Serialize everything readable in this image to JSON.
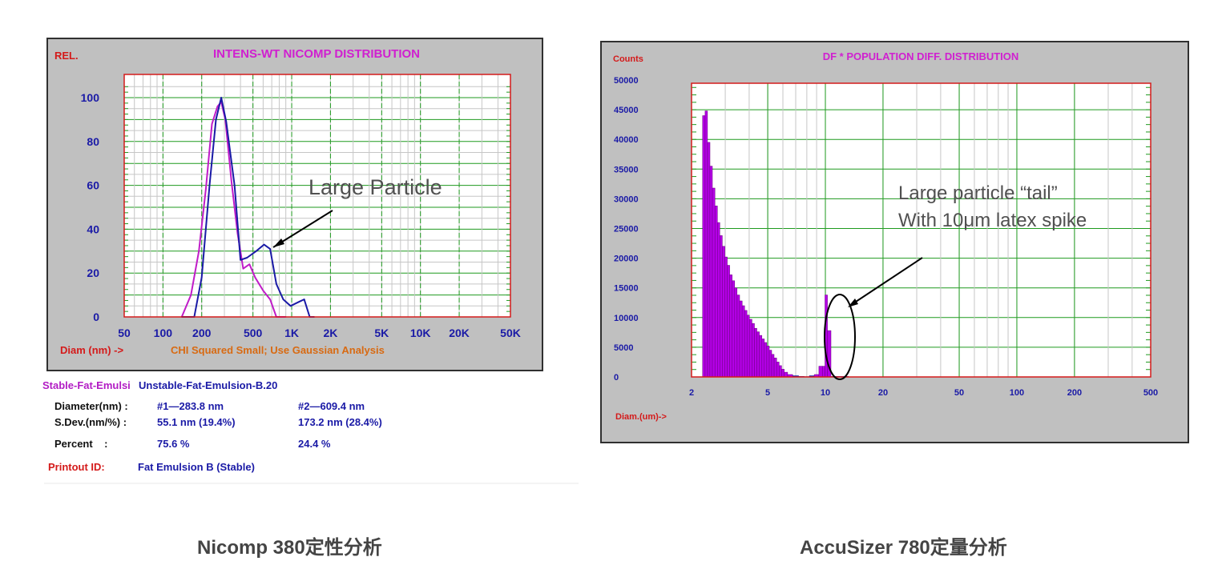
{
  "nicomp": {
    "title": "INTENS-WT NICOMP DISTRIBUTION",
    "y_corner_label": "REL.",
    "x_label": "Diam (nm) ->",
    "status_text": "CHI Squared Small; Use Gaussian Analysis",
    "annotation": "Large Particle",
    "y_ticks": [
      "100",
      "80",
      "60",
      "40",
      "20",
      "0"
    ],
    "x_ticks": [
      "50",
      "100",
      "200",
      "500",
      "1K",
      "2K",
      "5K",
      "10K",
      "20K",
      "50K"
    ],
    "legend": {
      "stable": "Stable-Fat-Emulsi",
      "unstable": "Unstable-Fat-Emulsion-B.20"
    },
    "stats": {
      "diameter_label": "Diameter(nm) :",
      "diameter_1": "#1—283.8 nm",
      "diameter_2": "#2—609.4 nm",
      "sdev_label": "S.Dev.(nm/%) :",
      "sdev_1": "55.1 nm (19.4%)",
      "sdev_2": "173.2 nm (28.4%)",
      "percent_label": "Percent    :",
      "percent_1": "75.6 %",
      "percent_2": "24.4 %",
      "printout_label": "Printout ID:",
      "printout_value": "Fat Emulsion B (Stable)"
    },
    "caption": "Nicomp 380定性分析"
  },
  "accusizer": {
    "title": "DF * POPULATION DIFF. DISTRIBUTION",
    "y_corner_label": "Counts",
    "x_label": "Diam.(um)->",
    "annotation_line1": "Large particle “tail”",
    "annotation_line2": "With 10μm latex spike",
    "y_ticks": [
      "50000",
      "45000",
      "40000",
      "35000",
      "30000",
      "25000",
      "20000",
      "15000",
      "10000",
      "5000",
      "0"
    ],
    "x_ticks": [
      "2",
      "5",
      "10",
      "20",
      "50",
      "100",
      "200",
      "500"
    ],
    "caption": "AccuSizer 780定量分析"
  },
  "colors": {
    "panel_bg": "#c0c0c0",
    "plot_bg": "#ffffff",
    "grid_major": "#1f9a1f",
    "grid_minor": "#c6c6c6",
    "axis_red": "#d41a1a",
    "blue_series": "#1a1aa6",
    "magenta_series": "#c01cc8",
    "bar_fill": "#b400e6",
    "title_magenta": "#d020d0",
    "status_orange": "#d86a12",
    "caption_gray": "#444444"
  },
  "chart_data": [
    {
      "type": "line",
      "title": "INTENS-WT NICOMP DISTRIBUTION",
      "xlabel": "Diam (nm) ->",
      "ylabel": "REL.",
      "x_scale": "log",
      "xlim": [
        50,
        50000
      ],
      "ylim": [
        0,
        100
      ],
      "grid": true,
      "series": [
        {
          "name": "Stable-Fat-Emulsi",
          "color": "#c01cc8",
          "x": [
            140,
            165,
            190,
            215,
            240,
            265,
            283.8,
            305,
            340,
            380,
            420,
            470,
            520,
            600,
            680,
            760,
            900
          ],
          "y": [
            0,
            10,
            30,
            58,
            88,
            96,
            98,
            90,
            62,
            38,
            22,
            24,
            18,
            12,
            8,
            0,
            0
          ]
        },
        {
          "name": "Unstable-Fat-Emulsion-B.20",
          "color": "#1a1aa6",
          "x": [
            140,
            175,
            200,
            230,
            258,
            283.8,
            310,
            360,
            400,
            450,
            530,
            609.4,
            680,
            760,
            860,
            980,
            1150,
            1250,
            1380,
            1500
          ],
          "y": [
            0,
            0,
            18,
            60,
            90,
            100,
            89,
            60,
            26,
            27,
            30,
            33,
            31,
            15,
            8,
            5,
            7,
            8,
            0,
            0
          ]
        }
      ]
    },
    {
      "type": "bar",
      "title": "DF * POPULATION DIFF. DISTRIBUTION",
      "xlabel": "Diam.(um)->",
      "ylabel": "Counts",
      "x_scale": "log",
      "xlim": [
        2,
        500
      ],
      "ylim": [
        0,
        50000
      ],
      "grid": true,
      "x": [
        2.25,
        2.32,
        2.39,
        2.46,
        2.53,
        2.61,
        2.69,
        2.77,
        2.85,
        2.94,
        3.03,
        3.12,
        3.21,
        3.31,
        3.41,
        3.51,
        3.62,
        3.73,
        3.84,
        3.95,
        4.07,
        4.2,
        4.32,
        4.45,
        4.59,
        4.73,
        4.87,
        5.02,
        5.17,
        5.32,
        5.48,
        5.65,
        5.82,
        6.0,
        6.2,
        6.5,
        7.0,
        7.5,
        8.0,
        8.5,
        9.0,
        9.5,
        9.8,
        10.1,
        10.4,
        11.0,
        12.0,
        13.0
      ],
      "values": [
        0,
        44000,
        44800,
        39500,
        35500,
        31800,
        28800,
        26000,
        23800,
        22000,
        20200,
        18800,
        17200,
        16200,
        15000,
        13800,
        12800,
        12000,
        11200,
        10400,
        9700,
        9000,
        8200,
        7600,
        7000,
        6400,
        5800,
        5200,
        4500,
        3800,
        3200,
        2500,
        1900,
        1300,
        800,
        400,
        200,
        100,
        60,
        200,
        400,
        1800,
        1800,
        13800,
        7800,
        100,
        100,
        100
      ]
    }
  ]
}
